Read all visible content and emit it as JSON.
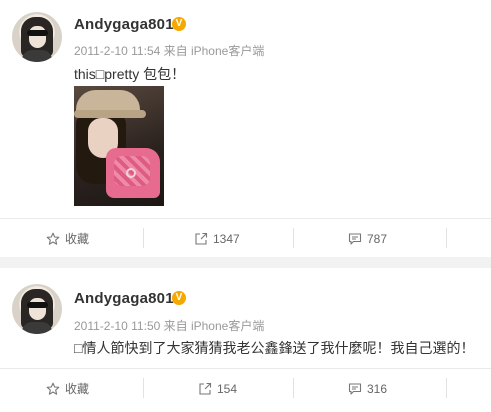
{
  "posts": [
    {
      "username": "Andygaga801",
      "verified_badge": "V",
      "meta": "2011-2-10 11:54 来自 iPhone客户端",
      "text": "this□pretty 包包！",
      "has_photo": true,
      "actions": {
        "favorite": "收藏",
        "repost": "1347",
        "comment": "787"
      }
    },
    {
      "username": "Andygaga801",
      "verified_badge": "V",
      "meta": "2011-2-10 11:50 来自 iPhone客户端",
      "text": "□情人節快到了大家猜猜我老公鑫鋒送了我什麼呢！我自己選的！",
      "has_photo": false,
      "actions": {
        "favorite": "收藏",
        "repost": "154",
        "comment": "316"
      }
    }
  ],
  "icons": {
    "favorite": "star-outline-icon",
    "repost": "share-arrow-icon",
    "comment": "comment-bubble-icon"
  },
  "colors": {
    "badge": "#f5a800",
    "background": "#f2f2f2",
    "card": "#ffffff",
    "meta_text": "#999999"
  }
}
